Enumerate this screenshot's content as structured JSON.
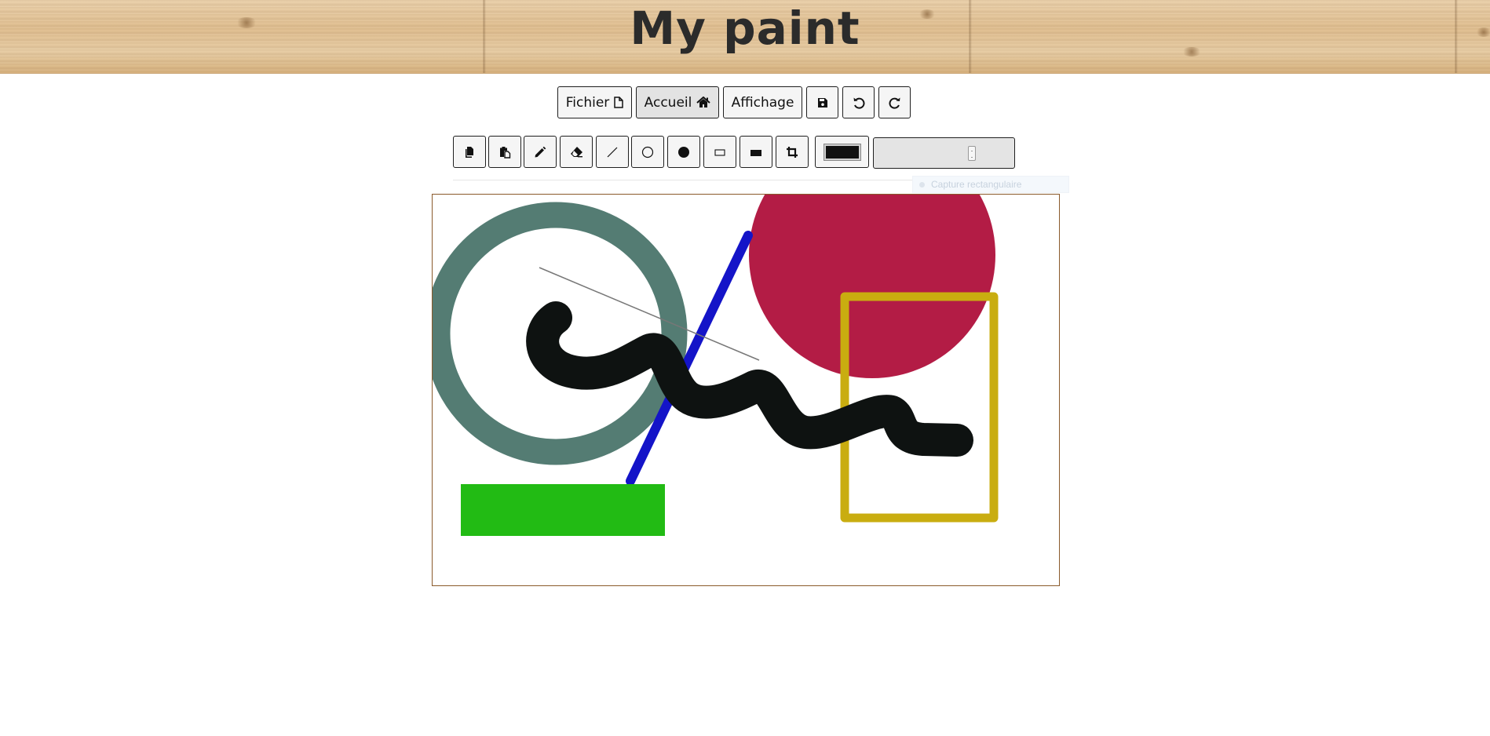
{
  "app": {
    "title": "My paint"
  },
  "menu": {
    "fichier_label": "Fichier",
    "accueil_label": "Accueil",
    "affichage_label": "Affichage",
    "active_tab": "Accueil"
  },
  "toolbar": {
    "tools": [
      {
        "name": "copy",
        "icon": "copy-icon"
      },
      {
        "name": "paste",
        "icon": "paste-icon"
      },
      {
        "name": "pencil",
        "icon": "pencil-icon"
      },
      {
        "name": "eraser",
        "icon": "eraser-icon"
      },
      {
        "name": "line",
        "icon": "line-icon"
      },
      {
        "name": "circle",
        "icon": "circle-outline-icon"
      },
      {
        "name": "filled-circle",
        "icon": "circle-filled-icon"
      },
      {
        "name": "rectangle",
        "icon": "rectangle-outline-icon"
      },
      {
        "name": "filled-rectangle",
        "icon": "rectangle-filled-icon"
      },
      {
        "name": "crop",
        "icon": "crop-icon"
      }
    ],
    "current_color": "#111111",
    "stroke_size": 0.72
  },
  "tooltip": {
    "text": "Capture rectangulaire"
  },
  "canvas": {
    "colors": {
      "ring": "#547c73",
      "blue_line": "#1414c8",
      "red_circle": "#b31c45",
      "gold_rect": "#c9ad10",
      "green_rect": "#22bb14",
      "black_stroke": "#0e1211",
      "thin_line": "#777777",
      "border": "#8a5a2b"
    }
  }
}
